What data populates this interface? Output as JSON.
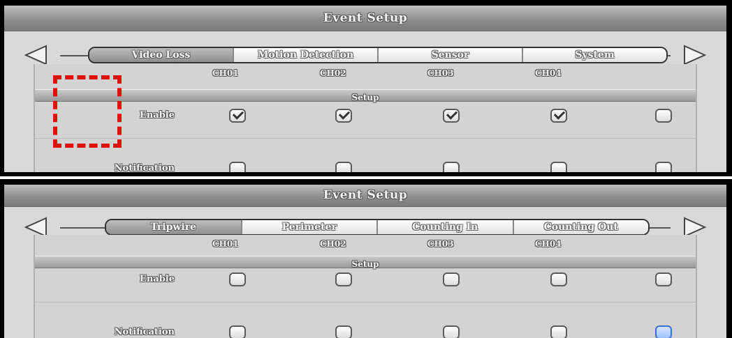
{
  "panels": [
    {
      "title": "Event Setup",
      "tabs": [
        "Video Loss",
        "Motion Detection",
        "Sensor",
        "System"
      ],
      "active_tab": 0,
      "channels": [
        "CH01",
        "CH02",
        "CH03",
        "CH04"
      ],
      "section": "Setup",
      "rows": [
        {
          "label": "Enable",
          "checks": [
            true,
            true,
            true,
            true,
            false
          ]
        },
        {
          "label": "Notification",
          "checks": [
            false,
            false,
            false,
            false,
            false
          ]
        }
      ]
    },
    {
      "title": "Event Setup",
      "tabs": [
        "Tripwire",
        "Perimeter",
        "Counting In",
        "Counting Out"
      ],
      "active_tab": 0,
      "channels": [
        "CH01",
        "CH02",
        "CH03",
        "CH04"
      ],
      "section": "Setup",
      "rows": [
        {
          "label": "Enable",
          "checks": [
            false,
            false,
            false,
            false,
            false
          ]
        },
        {
          "label": "Notification",
          "checks": [
            false,
            false,
            false,
            false,
            false
          ]
        }
      ],
      "focused_checkbox": "notification-col5"
    }
  ],
  "colors": {
    "highlight": "#e01010",
    "focus": "#9cc0ff"
  },
  "icons": {
    "prev": "left-arrow-icon",
    "next": "right-arrow-icon"
  }
}
